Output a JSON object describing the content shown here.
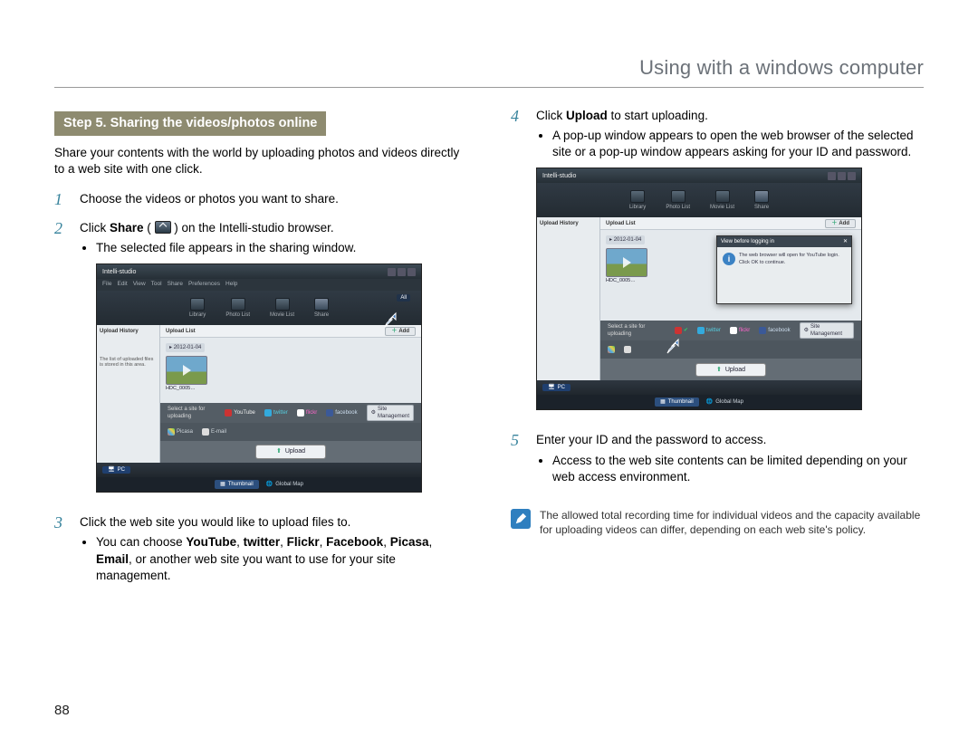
{
  "page_title": "Using with a windows computer",
  "page_number": "88",
  "section_heading": "Step 5. Sharing the videos/photos online",
  "intro": "Share your contents with the world by uploading photos and videos directly to a web site with one click.",
  "left_steps": {
    "s1": {
      "num": "1",
      "text": "Choose the videos or photos you want to share."
    },
    "s2": {
      "num": "2",
      "pre": "Click ",
      "bold": "Share",
      "post": " ( ",
      "post2": " ) on the Intelli-studio browser.",
      "bullet1": "The selected file appears in the sharing window."
    },
    "s3": {
      "num": "3",
      "text": "Click the web site you would like to upload files to.",
      "bullet_pre": "You can choose ",
      "sites": [
        "YouTube",
        "twitter",
        "Flickr",
        "Facebook",
        "Picasa",
        "Email"
      ],
      "bullet_post": ", or another web site you want to use for your site management."
    }
  },
  "right_steps": {
    "s4": {
      "num": "4",
      "pre": "Click ",
      "bold": "Upload",
      "post": " to start uploading.",
      "bullet1": "A pop-up window appears to open the web browser of the selected site or a pop-up window appears asking for your ID and password."
    },
    "s5": {
      "num": "5",
      "text": "Enter your ID and the password to access.",
      "bullet1": "Access to the web site contents can be limited depending on your web access environment."
    }
  },
  "note_text": "The allowed total recording time for individual videos and the capacity available for uploading videos can differ, depending on each web site's policy.",
  "shot": {
    "app_title": "Intelli-studio",
    "menus": [
      "File",
      "Edit",
      "View",
      "Tool",
      "Share",
      "Preferences",
      "Help"
    ],
    "toolbar": {
      "library": "Library",
      "photo": "Photo List",
      "movie": "Movie List",
      "share": "Share"
    },
    "side_header": "Upload History",
    "side_desc": "The list of uploaded files is stored in this area.",
    "list_header": "Upload List",
    "add_btn": "Add",
    "date": "2012-01-04",
    "thumb_caption": "HDC_0005…",
    "sites_label": "Select a site for uploading",
    "site_mgmt": "Site Management",
    "sites": {
      "youtube": "YouTube",
      "twitter": "twitter",
      "flickr": "flickr",
      "facebook": "facebook",
      "picasa": "Picasa",
      "email": "E-mail"
    },
    "upload_btn": "Upload",
    "pc_badge": "PC",
    "thumb_tab": "Thumbnail",
    "map_tab": "Global Map",
    "popup_title": "View before logging in",
    "popup_close": "✕",
    "popup_text": "The web browser will open for YouTube login. Click OK to continue.",
    "view_all": "All"
  }
}
